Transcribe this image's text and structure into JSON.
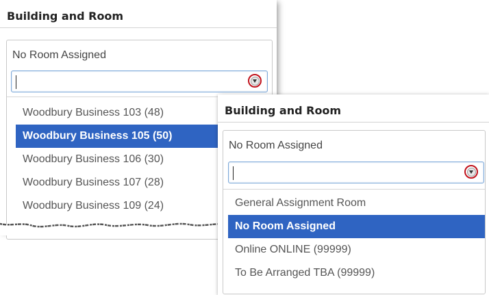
{
  "back_panel": {
    "title": "Building and Room",
    "current_value": "No Room Assigned",
    "combo_value": "",
    "options": [
      {
        "label": "Woodbury Business 103 (48)",
        "selected": false
      },
      {
        "label": "Woodbury Business 105 (50)",
        "selected": true
      },
      {
        "label": "Woodbury Business 106 (30)",
        "selected": false
      },
      {
        "label": "Woodbury Business 107 (28)",
        "selected": false
      },
      {
        "label": "Woodbury Business 109 (24)",
        "selected": false
      }
    ]
  },
  "front_panel": {
    "title": "Building and Room",
    "current_value": "No Room Assigned",
    "combo_value": "",
    "options": [
      {
        "label": "General Assignment Room",
        "selected": false
      },
      {
        "label": "No Room Assigned",
        "selected": true
      },
      {
        "label": "Online ONLINE (99999)",
        "selected": false
      },
      {
        "label": "To Be Arranged TBA (99999)",
        "selected": false
      }
    ]
  },
  "colors": {
    "selected_bg": "#2f64c2",
    "highlight_circle": "#c0101a",
    "combo_border": "#7aa7d9"
  },
  "icons": {
    "dropdown": "chevron-down-icon"
  }
}
